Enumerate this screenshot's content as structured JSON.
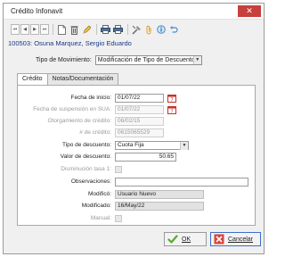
{
  "window": {
    "title": "Crédito Infonavit",
    "close_label": "✕"
  },
  "toolbar": {
    "nav": [
      "⏮",
      "◀",
      "▶",
      "⏭"
    ],
    "icons": [
      "new-document-icon",
      "delete-icon",
      "edit-icon",
      "print-icon",
      "print-preview-icon",
      "tools-icon",
      "attach-icon",
      "info-icon",
      "undo-icon"
    ]
  },
  "record": {
    "employee_line": "100503: Osuna Marquez, Sergio Eduardo"
  },
  "movimiento": {
    "label": "Tipo de Movimiento:",
    "value": "Modificación de Tipo de Descuento"
  },
  "tabs": [
    {
      "label": "Crédito",
      "active": true
    },
    {
      "label": "Notas/Documentación",
      "active": false
    }
  ],
  "form": {
    "fecha_inicio": {
      "label": "Fecha de inicio:",
      "value": "01/07/22"
    },
    "fecha_suspension": {
      "label": "Fecha de suspensión en SUA:",
      "value": "01/07/22"
    },
    "otorgamiento": {
      "label": "Otorgamiento de crédito:",
      "value": "06/02/15"
    },
    "num_credito": {
      "label": "# de crédito:",
      "value": "0615065529"
    },
    "tipo_descuento": {
      "label": "Tipo de descuento:",
      "value": "Cuota Fija"
    },
    "valor_descuento": {
      "label": "Valor de descuento:",
      "value": "50.65"
    },
    "disminucion": {
      "label": "Disminución tasa 1:"
    },
    "observaciones": {
      "label": "Observaciones:",
      "value": ""
    },
    "modifico": {
      "label": "Modificó:",
      "value": "Usuario Nuevo"
    },
    "modificado": {
      "label": "Modificado:",
      "value": "16/May/22"
    },
    "manual": {
      "label": "Manual:"
    }
  },
  "buttons": {
    "ok_label": "OK",
    "cancel_label": "Cancelar"
  },
  "colors": {
    "close_red": "#c7403c",
    "record_blue": "#173a8a",
    "ok_green": "#5aa832",
    "cancel_red": "#d9453c",
    "calendar_red": "#c9302c"
  }
}
